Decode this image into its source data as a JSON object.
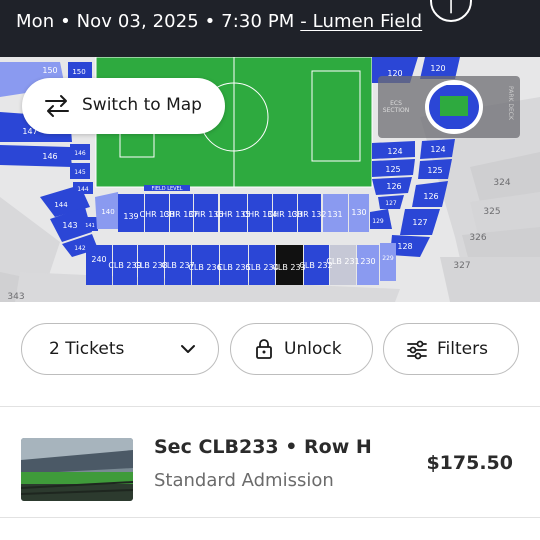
{
  "header": {
    "date_text": "Mon • Nov 03, 2025 • 7:30 PM",
    "venue_link": "- Lumen Field",
    "info_icon": "info-icon",
    "map_icon": "document-map-icon"
  },
  "map": {
    "switch_button_label": "Switch to Map",
    "switch_icon": "swap-arrows-icon",
    "minimap": {
      "left_label": "ECS SECTION",
      "right_label": "PARK DECK"
    },
    "field_label": "FIELD LEVEL",
    "sections": {
      "row_upper": [
        "139",
        "CHR 138",
        "CHR 137",
        "CHR 136",
        "CHR 135",
        "CHR 134",
        "CHR 133",
        "CHR 132",
        "131",
        "130"
      ],
      "row_lower": [
        "240",
        "CLB 239",
        "CLB 238",
        "CLB 237",
        "CLB 236",
        "CLB 235",
        "CLB 234",
        "CLB 233",
        "CLB 232",
        "CLB 231",
        "230",
        "229"
      ],
      "left": [
        "150",
        "150",
        "147",
        "146",
        "146",
        "145",
        "144",
        "144",
        "143",
        "142",
        "141",
        "140"
      ],
      "right": [
        "120",
        "120",
        "124",
        "124",
        "125",
        "125",
        "126",
        "126",
        "127",
        "127",
        "128",
        "129"
      ],
      "outer": [
        "324",
        "325",
        "326",
        "327",
        "343"
      ],
      "selected": "CLB 233"
    },
    "colors": {
      "available": "#2b46d6",
      "light_available": "#8a9af0",
      "selected": "#111111",
      "unavailable": "#d3d3d5",
      "pitch": "#2eaa3f"
    }
  },
  "filters": {
    "tickets_label": "2 Tickets",
    "unlock_label": "Unlock",
    "filters_label": "Filters"
  },
  "listing": {
    "title": "Sec CLB233 • Row H",
    "subtitle": "Standard Admission",
    "price": "$175.50"
  }
}
